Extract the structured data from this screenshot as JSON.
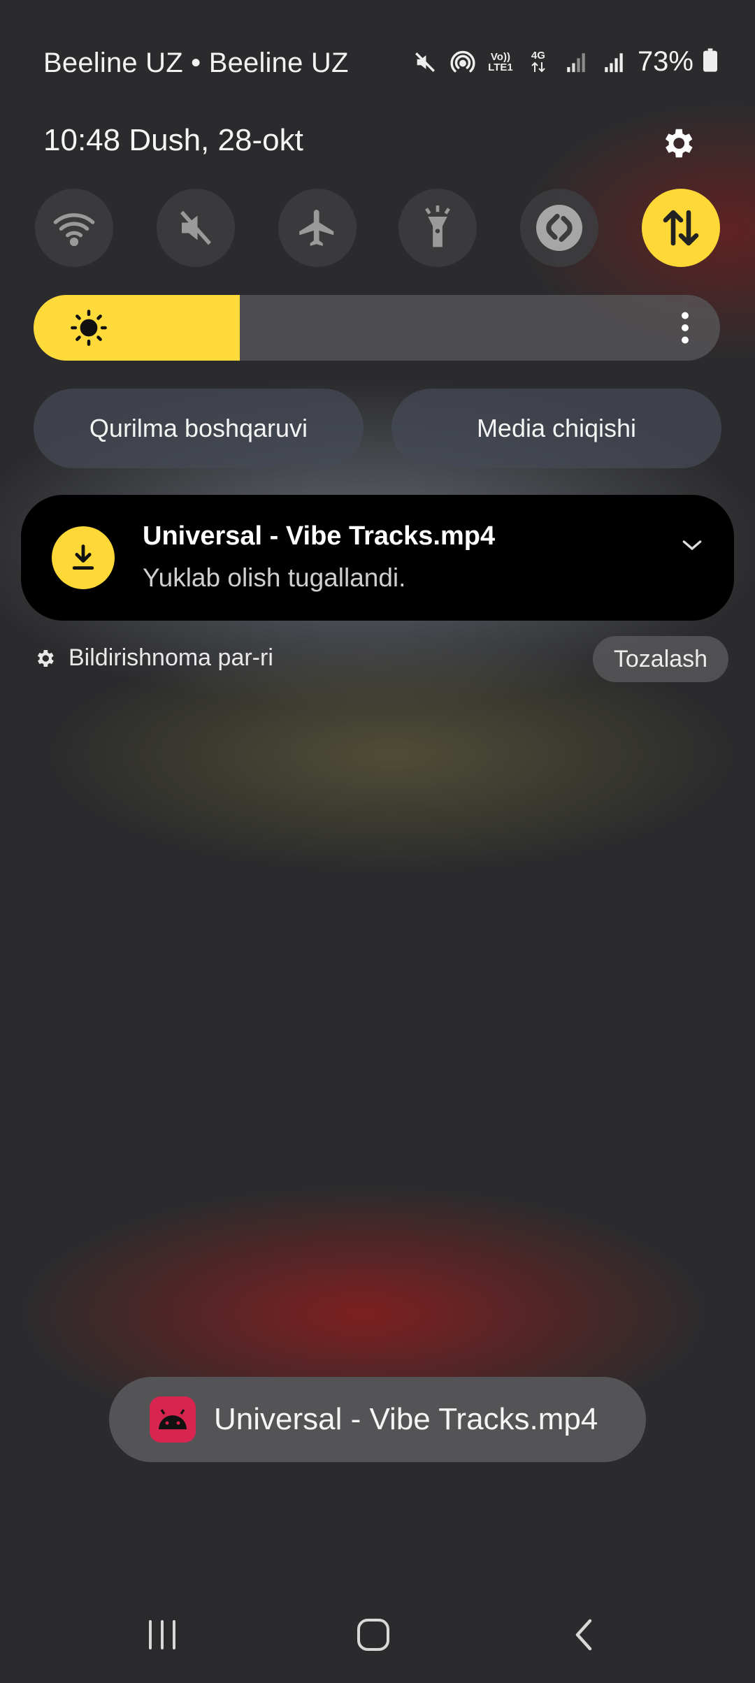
{
  "status_bar": {
    "carrier": "Beeline UZ • Beeline UZ",
    "volte_label_top": "Vo))",
    "volte_label_bottom": "LTE1",
    "network_type": "4G",
    "battery_percent": "73%",
    "icons": [
      "mute-icon",
      "hotspot-icon",
      "volte-icon",
      "data-arrows-icon",
      "signal-icon",
      "signal-icon",
      "battery-icon"
    ]
  },
  "header": {
    "time_date": "10:48  Dush, 28-okt",
    "settings_icon": "gear-icon"
  },
  "quick_toggles": [
    {
      "name": "wifi",
      "icon": "wifi-icon",
      "active": false
    },
    {
      "name": "sound",
      "icon": "mute-icon",
      "active": false
    },
    {
      "name": "airplane",
      "icon": "airplane-icon",
      "active": false
    },
    {
      "name": "flashlight",
      "icon": "flashlight-icon",
      "active": false
    },
    {
      "name": "shazam",
      "icon": "shazam-icon",
      "active": false
    },
    {
      "name": "mobile-data",
      "icon": "data-arrows-icon",
      "active": true
    }
  ],
  "brightness": {
    "level": 0.3,
    "accent": "#fedb3a"
  },
  "pills": {
    "device_control": "Qurilma boshqaruvi",
    "media_output": "Media chiqishi"
  },
  "notification": {
    "title": "Universal - Vibe Tracks.mp4",
    "text": "Yuklab olish tugallandi.",
    "icon": "download-icon",
    "accent": "#fdd836"
  },
  "notification_footer": {
    "settings_label": "Bildirishnoma par-ri",
    "clear_label": "Tozalash"
  },
  "toast": {
    "text": "Universal - Vibe Tracks.mp4",
    "icon": "android-icon",
    "icon_color": "#d7254f"
  },
  "nav_bar": [
    "recents-icon",
    "home-icon",
    "back-icon"
  ]
}
